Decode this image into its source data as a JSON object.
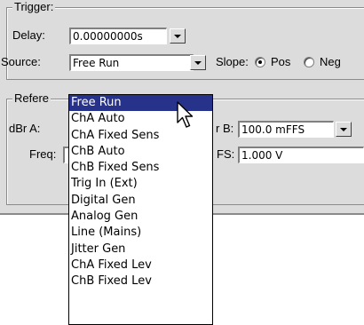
{
  "trigger": {
    "legend": "Trigger:",
    "delay_label": "Delay:",
    "delay_value": "0.00000000s",
    "source_label": "Source:",
    "source_value": "Free Run",
    "slope_label": "Slope:",
    "slope_options": [
      "Pos",
      "Neg"
    ],
    "slope_selected": "Pos"
  },
  "reference": {
    "legend": "Refere",
    "dbra_label": "dBr A:",
    "dbrb_label_fragment": "r B:",
    "dbrb_value": "100.0  mFFS",
    "freq_label": "Freq:",
    "vfs_label_fragment": "FS:",
    "vfs_value": "1.000   V"
  },
  "source_dropdown": {
    "options": [
      "Free Run",
      "ChA Auto",
      "ChA Fixed Sens",
      "ChB Auto",
      "ChB Fixed Sens",
      "Trig In (Ext)",
      "Digital Gen",
      "Analog Gen",
      "Line (Mains)",
      "Jitter Gen",
      "ChA Fixed Lev",
      "ChB Fixed Lev"
    ],
    "highlighted": "Free Run"
  },
  "icons": {
    "dropdown_arrow": "chevron-down-icon",
    "pointer": "mouse-pointer-icon"
  },
  "colors": {
    "panel_bg": "#dcdcdc",
    "selection_bg": "#27338a",
    "selection_text": "#ffffff"
  }
}
